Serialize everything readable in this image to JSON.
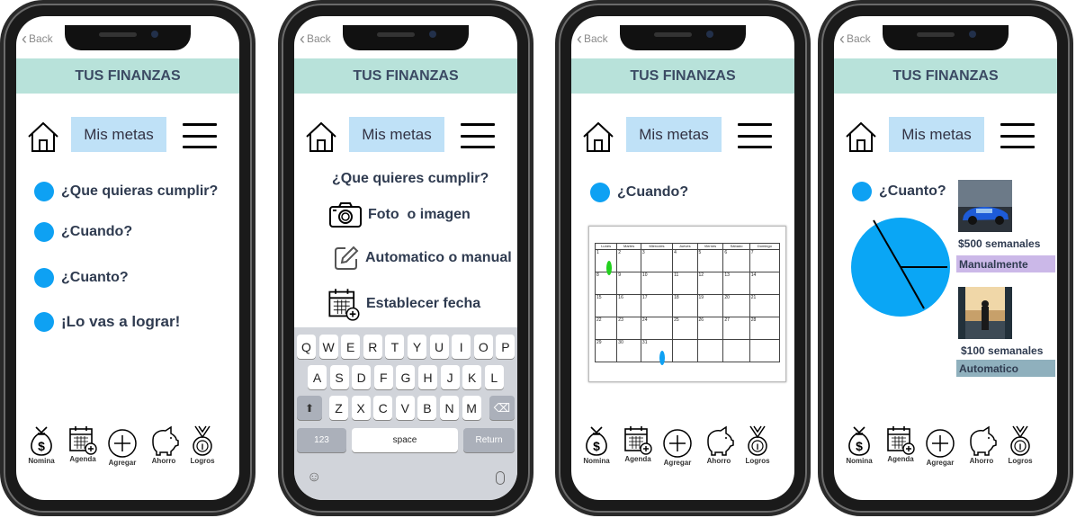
{
  "common": {
    "back_label": "Back",
    "header_title": "TUS FINANZAS",
    "metas_label": "Mis metas"
  },
  "nav": {
    "nomina": "Nomina",
    "agenda": "Agenda",
    "agregar": "Agregar",
    "ahorro": "Ahorro",
    "logros": "Logros"
  },
  "screen1": {
    "items": [
      "¿Que quieras cumplir?",
      "¿Cuando?",
      "¿Cuanto?",
      "¡Lo vas a lograr!"
    ]
  },
  "screen2": {
    "question": "¿Que quieres cumplir?",
    "options": [
      "Foto  o imagen",
      "Automatico o manual",
      "Establecer fecha"
    ],
    "keyboard": {
      "row1": [
        "Q",
        "W",
        "E",
        "R",
        "T",
        "Y",
        "U",
        "I",
        "O",
        "P"
      ],
      "row2": [
        "A",
        "S",
        "D",
        "F",
        "G",
        "H",
        "J",
        "K",
        "L"
      ],
      "row3": [
        "Z",
        "X",
        "C",
        "V",
        "B",
        "N",
        "M"
      ],
      "num_key": "123",
      "space_key": "space",
      "return_key": "Return"
    }
  },
  "screen3": {
    "question": "¿Cuando?",
    "calendar": {
      "days": [
        "Lunes",
        "Martes",
        "Miercoles",
        "Jueves",
        "Viernes",
        "Sábado",
        "Domingo"
      ],
      "weeks": [
        [
          "1",
          "2",
          "3",
          "4",
          "5",
          "6",
          "7"
        ],
        [
          "8",
          "9",
          "10",
          "11",
          "12",
          "13",
          "14"
        ],
        [
          "15",
          "16",
          "17",
          "18",
          "19",
          "20",
          "21"
        ],
        [
          "22",
          "23",
          "24",
          "25",
          "26",
          "27",
          "28"
        ],
        [
          "29",
          "30",
          "31",
          "",
          "",
          "",
          ""
        ]
      ]
    }
  },
  "screen4": {
    "question": "¿Cuanto?",
    "goals": [
      {
        "amount": "$500 semanales",
        "mode": "Manualmente",
        "mode_color": "#cbb8e8"
      },
      {
        "amount": "$100 semanales",
        "mode": "Automatico",
        "mode_color": "#8fb0bd"
      }
    ]
  },
  "colors": {
    "header": "#b8e2da",
    "metas": "#bfe1f7",
    "accent_blue": "#0ea1f3",
    "calendar_green": "#22d11e"
  }
}
